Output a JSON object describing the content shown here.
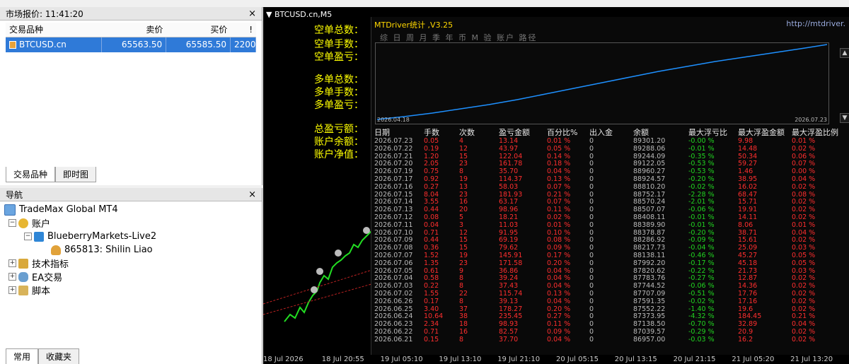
{
  "market_watch": {
    "title": "市场报价: 11:41:20",
    "headers": [
      "交易品种",
      "卖价",
      "买价",
      "!"
    ],
    "row": {
      "symbol": "BTCUSD.cn",
      "bid": "65563.50",
      "ask": "65585.50",
      "spread": "2200"
    },
    "tabs": [
      "交易品种",
      "即时图"
    ]
  },
  "navigator": {
    "title": "导航",
    "root": "TradeMax Global MT4",
    "accounts": "账户",
    "broker": "BlueberryMarkets-Live2",
    "account": "865813: Shilin Liao",
    "indicators": "技术指标",
    "ea": "EA交易",
    "scripts": "脚本",
    "tabs": [
      "常用",
      "收藏夹"
    ]
  },
  "chart": {
    "title": "BTCUSD.cn,M5",
    "stat_lines": [
      "空单总数：",
      "空单手数：",
      "空单盈亏：",
      "多单总数：",
      "多单手数：",
      "多单盈亏：",
      "总盈亏额：",
      "账户余额：",
      "账户净值："
    ],
    "time_axis": [
      "18 Jul 2026",
      "18 Jul 20:55",
      "19 Jul 05:10",
      "19 Jul 13:10",
      "19 Jul 21:10",
      "20 Jul 05:15",
      "20 Jul 13:15",
      "20 Jul 21:15",
      "21 Jul 05:20",
      "21 Jul 13:20"
    ]
  },
  "panel": {
    "title": "MTDriver统计 ,V3.25",
    "url": "http://mtdriver.",
    "menu": "综 日 周 月 季 年 币 M 验 账户   路径",
    "equity_start": "2026.04.18",
    "equity_end": "2026.07.23",
    "headers": [
      "日期",
      "手数",
      "次数",
      "盈亏金额",
      "百分比%",
      "出入金",
      "余额",
      "最大浮亏比",
      "最大浮盈金额",
      "最大浮盈比例"
    ],
    "rows": [
      [
        "2026.07.23",
        "0.05",
        "4",
        "13.14",
        "0.01 %",
        "0",
        "89301.20",
        "-0.00 %",
        "9.98",
        "0.01 %"
      ],
      [
        "2026.07.22",
        "0.19",
        "12",
        "43.97",
        "0.05 %",
        "0",
        "89288.06",
        "-0.01 %",
        "14.48",
        "0.02 %"
      ],
      [
        "2026.07.21",
        "1.20",
        "15",
        "122.04",
        "0.14 %",
        "0",
        "89244.09",
        "-0.35 %",
        "50.34",
        "0.06 %"
      ],
      [
        "2026.07.20",
        "2.05",
        "23",
        "161.78",
        "0.18 %",
        "0",
        "89122.05",
        "-0.53 %",
        "59.27",
        "0.07 %"
      ],
      [
        "2026.07.19",
        "0.75",
        "8",
        "35.70",
        "0.04 %",
        "0",
        "88960.27",
        "-0.53 %",
        "1.46",
        "0.00 %"
      ],
      [
        "2026.07.17",
        "0.92",
        "19",
        "114.37",
        "0.13 %",
        "0",
        "88924.57",
        "-0.20 %",
        "38.95",
        "0.04 %"
      ],
      [
        "2026.07.16",
        "0.27",
        "13",
        "58.03",
        "0.07 %",
        "0",
        "88810.20",
        "-0.02 %",
        "16.02",
        "0.02 %"
      ],
      [
        "2026.07.15",
        "8.04",
        "23",
        "181.93",
        "0.21 %",
        "0",
        "88752.17",
        "-2.28 %",
        "68.47",
        "0.08 %"
      ],
      [
        "2026.07.14",
        "3.55",
        "16",
        "63.17",
        "0.07 %",
        "0",
        "88570.24",
        "-2.01 %",
        "15.71",
        "0.02 %"
      ],
      [
        "2026.07.13",
        "0.44",
        "20",
        "98.96",
        "0.11 %",
        "0",
        "88507.07",
        "-0.06 %",
        "19.91",
        "0.02 %"
      ],
      [
        "2026.07.12",
        "0.08",
        "5",
        "18.21",
        "0.02 %",
        "0",
        "88408.11",
        "-0.01 %",
        "14.11",
        "0.02 %"
      ],
      [
        "2026.07.11",
        "0.04",
        "3",
        "11.03",
        "0.01 %",
        "0",
        "88389.90",
        "-0.01 %",
        "8.06",
        "0.01 %"
      ],
      [
        "2026.07.10",
        "0.71",
        "12",
        "91.95",
        "0.10 %",
        "0",
        "88378.87",
        "-0.20 %",
        "38.71",
        "0.04 %"
      ],
      [
        "2026.07.09",
        "0.44",
        "15",
        "69.19",
        "0.08 %",
        "0",
        "88286.92",
        "-0.09 %",
        "15.61",
        "0.02 %"
      ],
      [
        "2026.07.08",
        "0.36",
        "15",
        "79.62",
        "0.09 %",
        "0",
        "88217.73",
        "-0.04 %",
        "25.09",
        "0.03 %"
      ],
      [
        "2026.07.07",
        "1.52",
        "19",
        "145.91",
        "0.17 %",
        "0",
        "88138.11",
        "-0.46 %",
        "45.27",
        "0.05 %"
      ],
      [
        "2026.07.06",
        "1.35",
        "23",
        "171.58",
        "0.20 %",
        "0",
        "87992.20",
        "-0.17 %",
        "45.18",
        "0.05 %"
      ],
      [
        "2026.07.05",
        "0.61",
        "9",
        "36.86",
        "0.04 %",
        "0",
        "87820.62",
        "-0.22 %",
        "21.73",
        "0.03 %"
      ],
      [
        "2026.07.04",
        "0.58",
        "8",
        "39.24",
        "0.04 %",
        "0",
        "87783.76",
        "-0.27 %",
        "12.87",
        "0.02 %"
      ],
      [
        "2026.07.03",
        "0.22",
        "8",
        "37.43",
        "0.04 %",
        "0",
        "87744.52",
        "-0.06 %",
        "14.36",
        "0.02 %"
      ],
      [
        "2026.07.02",
        "1.55",
        "22",
        "115.74",
        "0.13 %",
        "0",
        "87707.09",
        "-0.51 %",
        "17.76",
        "0.02 %"
      ],
      [
        "2026.06.26",
        "0.17",
        "8",
        "39.13",
        "0.04 %",
        "0",
        "87591.35",
        "-0.02 %",
        "17.16",
        "0.02 %"
      ],
      [
        "2026.06.25",
        "3.40",
        "37",
        "178.27",
        "0.20 %",
        "0",
        "87552.22",
        "-1.40 %",
        "19.6",
        "0.02 %"
      ],
      [
        "2026.06.24",
        "10.64",
        "38",
        "235.45",
        "0.27 %",
        "0",
        "87373.95",
        "-4.32 %",
        "184.45",
        "0.21 %"
      ],
      [
        "2026.06.23",
        "2.34",
        "18",
        "98.93",
        "0.11 %",
        "0",
        "87138.50",
        "-0.70 %",
        "32.89",
        "0.04 %"
      ],
      [
        "2026.06.22",
        "0.71",
        "16",
        "82.57",
        "0.09 %",
        "0",
        "87039.57",
        "-0.29 %",
        "20.9",
        "0.02 %"
      ],
      [
        "2026.06.21",
        "0.15",
        "8",
        "37.70",
        "0.04 %",
        "0",
        "86957.00",
        "-0.03 %",
        "16.2",
        "0.02 %"
      ]
    ]
  },
  "colors": {
    "selection": "#2f7ad8",
    "stat_yellow": "#ffff00",
    "panel_red": "#ff2e2e",
    "equity_line": "#1e90ff"
  }
}
